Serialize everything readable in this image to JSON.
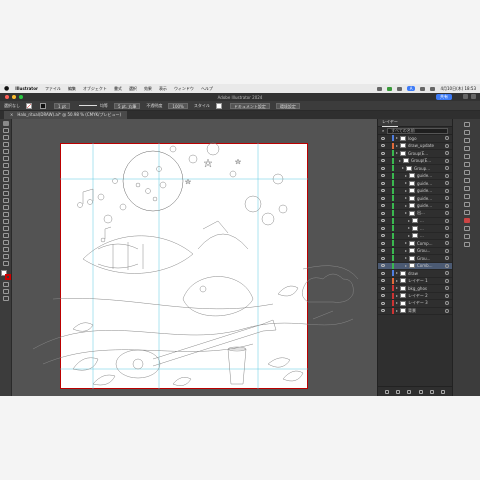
{
  "menubar": {
    "app": "Illustrator",
    "items": [
      "ファイル",
      "編集",
      "オブジェクト",
      "書式",
      "選択",
      "効果",
      "表示",
      "ウィンドウ",
      "ヘルプ"
    ],
    "ai_badge": "A",
    "clock": "4月10日(木) 18:53"
  },
  "titlebar": {
    "title": "Adobe Illustrator 2024",
    "share": "共有"
  },
  "controlbar": {
    "selection": "選択なし",
    "stroke_weight": "1 pt",
    "stroke_profile": "均等",
    "brush": "5 pt. 丸筆",
    "opacity_label": "不透明度",
    "opacity": "100%",
    "style_label": "スタイル",
    "doc_setup": "ドキュメント設定",
    "prefs": "環境設定"
  },
  "doctab": {
    "close": "×",
    "title": "Halo_ritual(DRAW).ai* @ 50.98 % (CMYK/プレビュー)"
  },
  "layers_panel": {
    "tab": "レイヤー",
    "search_placeholder": "すべての名前",
    "layers": [
      {
        "name": "logo",
        "color": "#4f7ee0"
      },
      {
        "name": "draw_update",
        "color": "#e06a3a"
      },
      {
        "name": "Group(E...",
        "color": "#3ab84f"
      },
      {
        "name": "Group(E...",
        "color": "#3ab84f"
      },
      {
        "name": "Group...",
        "color": "#3ab84f"
      },
      {
        "name": "guide...",
        "color": "#3ab84f"
      },
      {
        "name": "guide...",
        "color": "#3ab84f"
      },
      {
        "name": "guide...",
        "color": "#3ab84f"
      },
      {
        "name": "guide...",
        "color": "#3ab84f"
      },
      {
        "name": "guide...",
        "color": "#3ab84f"
      },
      {
        "name": "出...",
        "color": "#3ab84f"
      },
      {
        "name": "...",
        "color": "#3ab84f"
      },
      {
        "name": "...",
        "color": "#3ab84f"
      },
      {
        "name": "...",
        "color": "#3ab84f"
      },
      {
        "name": "Comp...",
        "color": "#3ab84f"
      },
      {
        "name": "Grou...",
        "color": "#3ab84f"
      },
      {
        "name": "Grou...",
        "color": "#3ab84f"
      },
      {
        "name": "Comb...",
        "color": "#3ab84f"
      },
      {
        "name": "draw",
        "color": "#4f7ee0"
      },
      {
        "name": "レイヤー 1",
        "color": "#e06a3a"
      },
      {
        "name": "bkg_ghos",
        "color": "#c33"
      },
      {
        "name": "レイヤー 2",
        "color": "#c33"
      },
      {
        "name": "レイヤー 3",
        "color": "#c33"
      },
      {
        "name": "背景",
        "color": "#c33"
      }
    ],
    "selected_index": 17
  }
}
